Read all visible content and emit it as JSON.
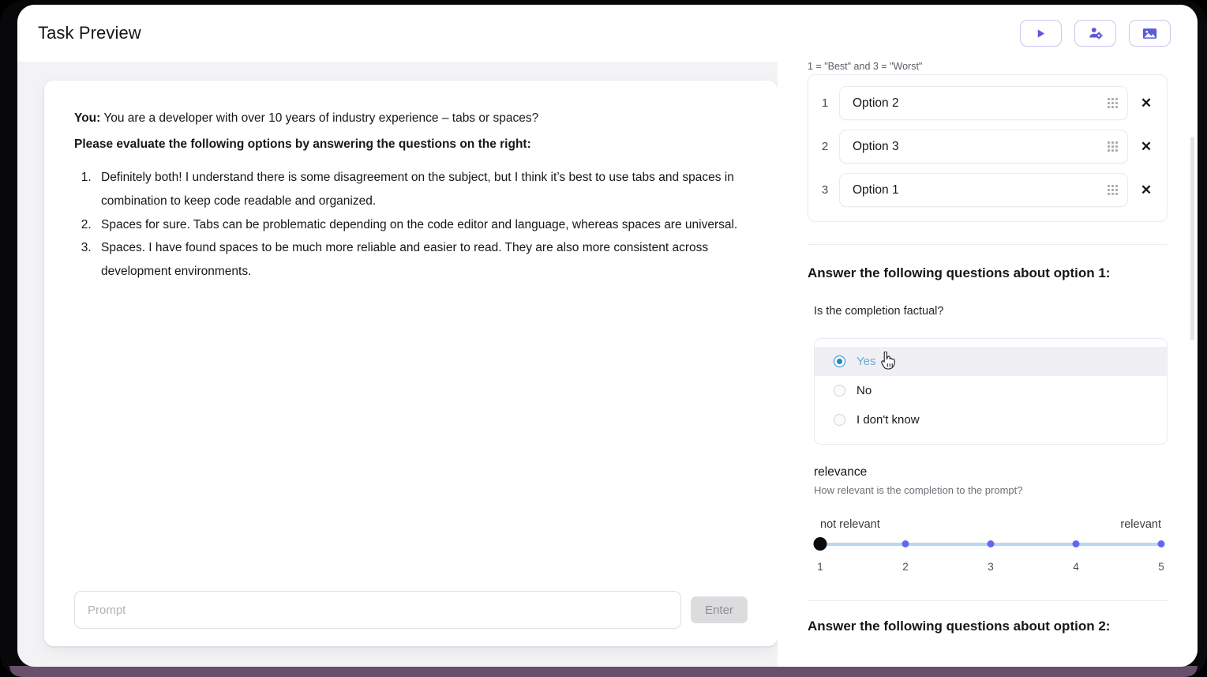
{
  "header": {
    "title": "Task Preview",
    "actions": [
      {
        "name": "run-preview-button",
        "icon": "play-icon",
        "label": ""
      },
      {
        "name": "manage-annotators-button",
        "icon": "user-settings-icon",
        "label": ""
      },
      {
        "name": "media-button",
        "icon": "image-icon",
        "label": ""
      }
    ]
  },
  "chat": {
    "speaker": "You:",
    "prompt_text": " You are a developer with over 10 years of industry experience – tabs or spaces?",
    "instruction": "Please evaluate the following options by answering the questions on the right:",
    "options": [
      "Definitely both! I understand there is some disagreement on the subject, but I think it’s best to use tabs and spaces in combination to keep code readable and organized.",
      "Spaces for sure. Tabs can be problematic depending on the code editor and language, whereas spaces are universal.",
      "Spaces. I have found spaces to be much more reliable and easier to read. They are also more consistent across development environments."
    ],
    "input_placeholder": "Prompt",
    "input_value": "",
    "submit_label": "Enter"
  },
  "ranking": {
    "hint": "1 = \"Best\" and 3 = \"Worst\"",
    "rows": [
      {
        "rank": "1",
        "label": "Option 2",
        "handle": "drag-handle-icon",
        "remove": "✕"
      },
      {
        "rank": "2",
        "label": "Option 3",
        "handle": "drag-handle-icon",
        "remove": "✕"
      },
      {
        "rank": "3",
        "label": "Option 1",
        "handle": "drag-handle-icon",
        "remove": "✕"
      }
    ]
  },
  "option_section": {
    "heading": "Answer the following questions about option 1:",
    "factual_question": {
      "label": "Is the completion factual?",
      "choices": [
        {
          "label": "Yes",
          "selected": true
        },
        {
          "label": "No",
          "selected": false
        },
        {
          "label": "I don't know",
          "selected": false
        }
      ]
    },
    "relevance": {
      "name": "relevance",
      "description": "How relevant is the completion to the prompt?",
      "left_end_label": "not relevant",
      "right_end_label": "relevant",
      "ticks": [
        "1",
        "2",
        "3",
        "4",
        "5"
      ],
      "value": 1,
      "min": 1,
      "max": 5
    }
  },
  "next_section": {
    "heading": "Answer the following questions about option 2:"
  },
  "colors": {
    "accent_purple": "#6366f1",
    "accent_purple_border": "#c9c6ee",
    "radio_blue": "#1f87c7",
    "selected_label_blue": "#6aa9d8",
    "slider_track": "#b9d7f2",
    "slider_thumb": "#0b0b0e",
    "frame_accent": "#6a4f6b",
    "app_background": "#f3f3f5"
  }
}
